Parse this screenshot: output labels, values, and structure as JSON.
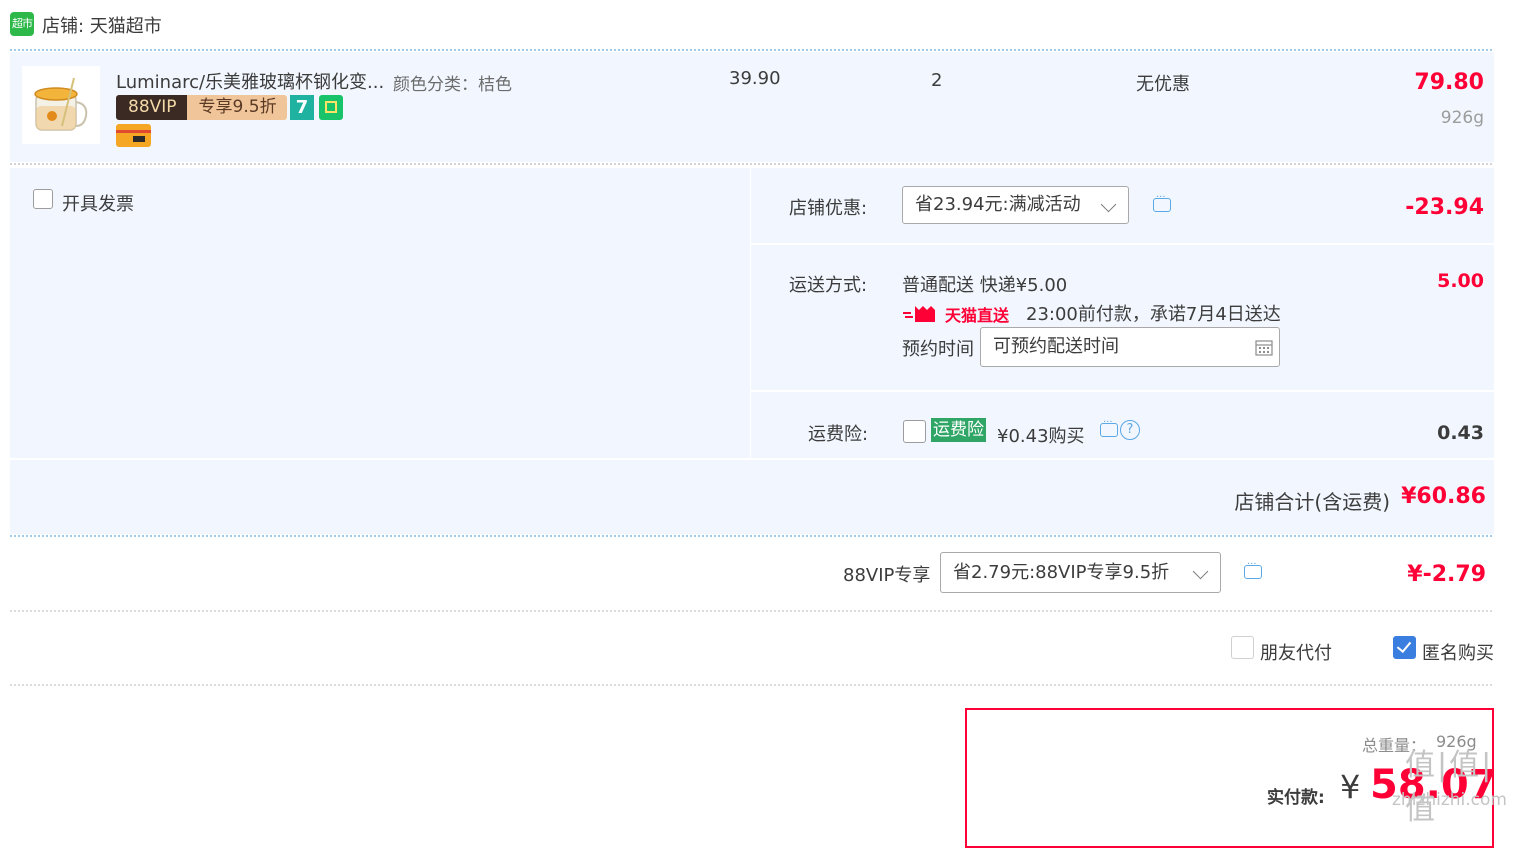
{
  "shop": {
    "icon_label": "超市",
    "name_label": "店铺: 天猫超市"
  },
  "item": {
    "title": "Luminarc/乐美雅玻璃杯钢化变...",
    "attr": "颜色分类：桔色",
    "vip_tag_left": "88VIP",
    "vip_tag_right": "专享9.5折",
    "badge_7": "7",
    "price": "39.90",
    "qty": "2",
    "promo": "无优惠",
    "subtotal": "79.80",
    "weight": "926g"
  },
  "invoice": {
    "label": "开具发票"
  },
  "shop_discount": {
    "label": "店铺优惠:",
    "selected": "省23.94元:满减活动",
    "amount": "-23.94"
  },
  "shipping": {
    "label": "运送方式:",
    "method": "普通配送 快递¥5.00",
    "tmall_direct": "天猫直送",
    "promise": "23:00前付款，承诺7月4日送达",
    "reserve_label": "预约时间",
    "reserve_placeholder": "可预约配送时间",
    "amount": "5.00"
  },
  "insurance": {
    "label": "运费险:",
    "tag": "运费险",
    "text": "¥0.43购买",
    "help": "?",
    "amount": "0.43"
  },
  "shop_total": {
    "label": "店铺合计(含运费)",
    "amount": "¥60.86"
  },
  "vip": {
    "label": "88VIP专享",
    "selected": "省2.79元:88VIP专享9.5折",
    "amount": "¥-2.79"
  },
  "options": {
    "friend_pay": "朋友代付",
    "anonymous": "匿名购买"
  },
  "payment": {
    "total_weight_label": "总重量：",
    "total_weight": "926g",
    "pay_label": "实付款:",
    "currency": "¥",
    "amount": "58.07",
    "watermark": "值|值|值",
    "watermark_url": "zhizhizhi.com"
  }
}
